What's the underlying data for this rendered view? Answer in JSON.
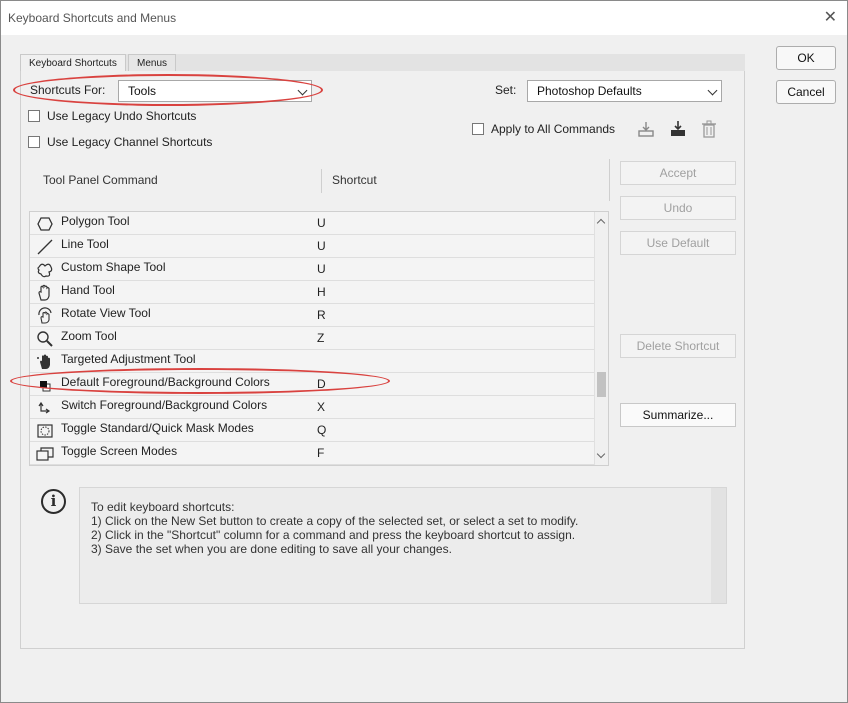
{
  "window": {
    "title": "Keyboard Shortcuts and Menus",
    "close_glyph": "✕"
  },
  "tabs": [
    {
      "label": "Keyboard Shortcuts",
      "active": true
    },
    {
      "label": "Menus",
      "active": false
    }
  ],
  "shortcuts_for": {
    "label": "Shortcuts For:",
    "value": "Tools"
  },
  "set": {
    "label": "Set:",
    "value": "Photoshop Defaults"
  },
  "checkboxes": {
    "legacy_undo": {
      "label": "Use Legacy Undo Shortcuts",
      "checked": false
    },
    "legacy_channel": {
      "label": "Use Legacy Channel Shortcuts",
      "checked": false
    },
    "apply_all": {
      "label": "Apply to All Commands",
      "checked": false
    }
  },
  "set_icons": [
    "save-set-icon",
    "new-set-icon",
    "delete-set-icon"
  ],
  "table": {
    "headers": {
      "command": "Tool Panel Command",
      "shortcut": "Shortcut"
    },
    "rows": [
      {
        "icon": "polygon-icon",
        "command": "Polygon Tool",
        "shortcut": "U"
      },
      {
        "icon": "line-icon",
        "command": "Line Tool",
        "shortcut": "U"
      },
      {
        "icon": "custom-shape-icon",
        "command": "Custom Shape Tool",
        "shortcut": "U"
      },
      {
        "icon": "hand-icon",
        "command": "Hand Tool",
        "shortcut": "H"
      },
      {
        "icon": "rotate-view-icon",
        "command": "Rotate View Tool",
        "shortcut": "R"
      },
      {
        "icon": "zoom-icon",
        "command": "Zoom Tool",
        "shortcut": "Z"
      },
      {
        "icon": "targeted-adjustment-icon",
        "command": "Targeted Adjustment Tool",
        "shortcut": ""
      },
      {
        "icon": "default-colors-icon",
        "command": "Default Foreground/Background Colors",
        "shortcut": "D"
      },
      {
        "icon": "switch-colors-icon",
        "command": "Switch Foreground/Background Colors",
        "shortcut": "X"
      },
      {
        "icon": "quick-mask-icon",
        "command": "Toggle Standard/Quick Mask Modes",
        "shortcut": "Q"
      },
      {
        "icon": "screen-modes-icon",
        "command": "Toggle Screen Modes",
        "shortcut": "F"
      }
    ]
  },
  "buttons": {
    "ok": "OK",
    "cancel": "Cancel",
    "accept": "Accept",
    "undo": "Undo",
    "use_default": "Use Default",
    "delete_shortcut": "Delete Shortcut",
    "summarize": "Summarize..."
  },
  "info": {
    "icon_glyph": "i",
    "lines": [
      "To edit keyboard shortcuts:",
      "1) Click on the New Set button to create a copy of the selected set, or select a set to modify.",
      "2) Click in the \"Shortcut\" column for a command and press the keyboard shortcut to assign.",
      "3) Save the set when you are done editing to save all your changes."
    ]
  },
  "colors": {
    "annotation": "#d9423f",
    "disabled_text": "#a0a0a0"
  }
}
